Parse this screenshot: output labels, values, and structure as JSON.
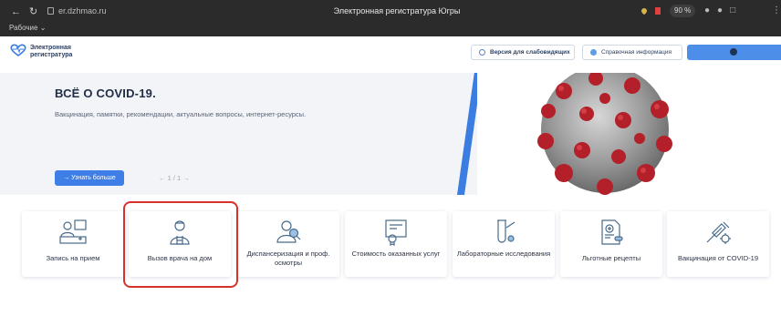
{
  "browser": {
    "url": "er.dzhmao.ru",
    "tab_title": "Электронная регистратура Югры",
    "zoom": "90 %",
    "profile": "Рабочие"
  },
  "header": {
    "logo_line1": "Электронная",
    "logo_line2": "регистратура",
    "vision_btn": "Версия для слабовидящих",
    "info_btn": "Справочная информация"
  },
  "hero": {
    "title": "ВСЁ О COVID-19.",
    "subtitle": "Вакцинация, памятки, рекомендации, актуальные вопросы, интернет-ресурсы.",
    "button": "Узнать больше",
    "pager": "1 / 1"
  },
  "services": [
    {
      "label": "Запись на прием",
      "icon": "appointment-icon"
    },
    {
      "label": "Вызов врача на дом",
      "icon": "doctor-icon"
    },
    {
      "label": "Диспансеризация и проф. осмотры",
      "icon": "checkup-icon"
    },
    {
      "label": "Стоимость оказанных услуг",
      "icon": "cost-certificate-icon"
    },
    {
      "label": "Лабораторные исследования",
      "icon": "lab-tube-icon"
    },
    {
      "label": "Льготные рецепты",
      "icon": "prescription-icon"
    },
    {
      "label": "Вакцинация от COVID-19",
      "icon": "syringe-virus-icon"
    }
  ],
  "colors": {
    "accent": "#3f7ee6",
    "highlight": "#d6312c",
    "virus_red": "#b3202a"
  }
}
